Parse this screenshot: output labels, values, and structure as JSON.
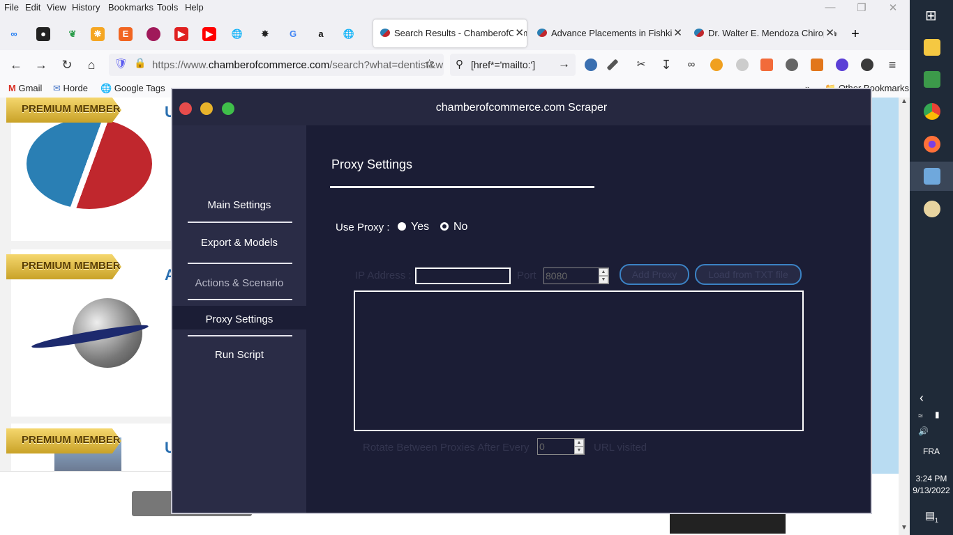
{
  "browser": {
    "menu": [
      "File",
      "Edit",
      "View",
      "History",
      "Bookmarks",
      "Tools",
      "Help"
    ],
    "tabs": [
      {
        "title": "Search Results - ChamberofCom"
      },
      {
        "title": "Advance Placements in Fishkill,"
      },
      {
        "title": "Dr. Walter E. Mendoza Chiroprac"
      }
    ],
    "url": {
      "prefix": "https://www.",
      "domain": "chamberofcommerce.com",
      "path": "/search?what=dentist&w"
    },
    "search_query": "[href*='mailto:']",
    "bookmarks": [
      "Gmail",
      "Horde",
      "Google Tags"
    ],
    "bookmarks_trailing": "Other Bookmarks"
  },
  "page_behind": {
    "badge": "PREMIUM MEMBER",
    "letters": [
      "U",
      "A",
      "U"
    ]
  },
  "app": {
    "title": "chamberofcommerce.com Scraper",
    "sidebar": [
      {
        "label": "Main Settings"
      },
      {
        "label": "Export & Models"
      },
      {
        "label": "Actions & Scenario"
      },
      {
        "label": "Proxy Settings"
      },
      {
        "label": "Run Script"
      }
    ],
    "section_title": "Proxy Settings",
    "use_proxy": {
      "label": "Use Proxy :",
      "yes": "Yes",
      "no": "No",
      "selected": "Yes"
    },
    "ip_label": "IP Address :",
    "ip_value": "",
    "port_label": "Port",
    "port_value": "8080",
    "add_proxy_label": "Add Proxy",
    "load_txt_label": "Load from TXT file",
    "rotate_label": "Rotate Between Proxies After Every",
    "rotate_value": "0",
    "rotate_unit": "URL visited"
  },
  "taskbar": {
    "language": "FRA",
    "time": "3:24 PM",
    "date": "9/13/2022",
    "notification_count": "1"
  },
  "colors": {
    "app_bg": "#1b1d35",
    "sidebar_bg": "#2a2c46",
    "accent_blue": "#3b82c4",
    "close_dot": "#e74c4c",
    "min_dot": "#e8b32b",
    "max_dot": "#3fbf4a"
  }
}
